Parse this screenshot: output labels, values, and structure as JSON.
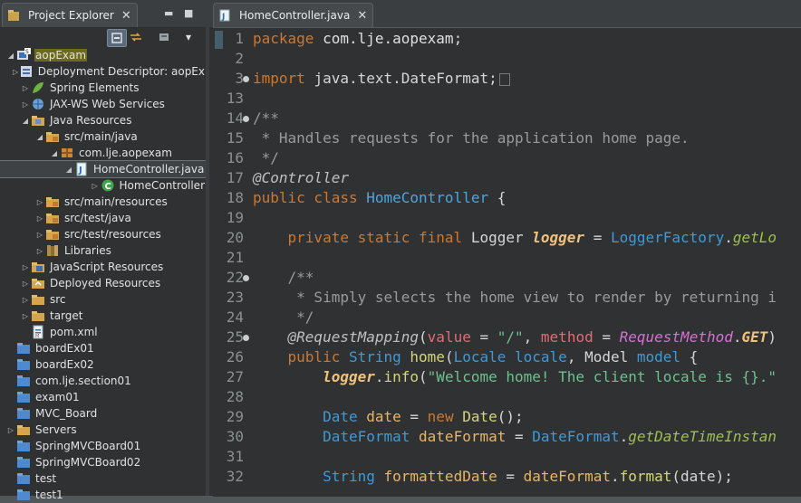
{
  "explorer": {
    "tab_title": "Project Explorer",
    "close": "✕",
    "min": "▬",
    "max": "■",
    "menu": "▾",
    "items": [
      {
        "label": "aopExam",
        "arrow": "open",
        "indent": 0,
        "icon": "project-icon"
      },
      {
        "label": "Deployment Descriptor: aopEx",
        "arrow": "closed",
        "indent": 1,
        "icon": "deployment-descriptor-icon"
      },
      {
        "label": "Spring Elements",
        "arrow": "closed",
        "indent": 1,
        "icon": "spring-leaf-icon"
      },
      {
        "label": "JAX-WS Web Services",
        "arrow": "closed",
        "indent": 1,
        "icon": "web-services-icon"
      },
      {
        "label": "Java Resources",
        "arrow": "open",
        "indent": 1,
        "icon": "java-resources-icon"
      },
      {
        "label": "src/main/java",
        "arrow": "open",
        "indent": 2,
        "icon": "source-folder-icon"
      },
      {
        "label": "com.lje.aopexam",
        "arrow": "open",
        "indent": 3,
        "icon": "package-icon"
      },
      {
        "label": "HomeController.java",
        "arrow": "open",
        "indent": 4,
        "icon": "java-file-icon"
      },
      {
        "label": "HomeController",
        "arrow": "closed",
        "indent": 5,
        "icon": "class-icon"
      },
      {
        "label": "src/main/resources",
        "arrow": "closed",
        "indent": 2,
        "icon": "source-folder-icon"
      },
      {
        "label": "src/test/java",
        "arrow": "closed",
        "indent": 2,
        "icon": "source-folder-icon"
      },
      {
        "label": "src/test/resources",
        "arrow": "closed",
        "indent": 2,
        "icon": "source-folder-icon"
      },
      {
        "label": "Libraries",
        "arrow": "closed",
        "indent": 2,
        "icon": "libraries-icon"
      },
      {
        "label": "JavaScript Resources",
        "arrow": "closed",
        "indent": 1,
        "icon": "javascript-resources-icon"
      },
      {
        "label": "Deployed Resources",
        "arrow": "closed",
        "indent": 1,
        "icon": "deployed-resources-icon"
      },
      {
        "label": "src",
        "arrow": "closed",
        "indent": 1,
        "icon": "folder-icon"
      },
      {
        "label": "target",
        "arrow": "closed",
        "indent": 1,
        "icon": "folder-icon"
      },
      {
        "label": "pom.xml",
        "arrow": "none",
        "indent": 1,
        "icon": "xml-file-icon"
      },
      {
        "label": "boardEx01",
        "arrow": "none",
        "indent": 0,
        "icon": "closed-project-icon"
      },
      {
        "label": "boardEx02",
        "arrow": "none",
        "indent": 0,
        "icon": "closed-project-icon"
      },
      {
        "label": "com.lje.section01",
        "arrow": "none",
        "indent": 0,
        "icon": "closed-project-icon"
      },
      {
        "label": "exam01",
        "arrow": "none",
        "indent": 0,
        "icon": "closed-project-icon"
      },
      {
        "label": "MVC_Board",
        "arrow": "none",
        "indent": 0,
        "icon": "closed-project-icon"
      },
      {
        "label": "Servers",
        "arrow": "closed",
        "indent": 0,
        "icon": "servers-folder-icon"
      },
      {
        "label": "SpringMVCBoard01",
        "arrow": "none",
        "indent": 0,
        "icon": "closed-project-icon"
      },
      {
        "label": "SpringMVCBoard02",
        "arrow": "none",
        "indent": 0,
        "icon": "closed-project-icon"
      },
      {
        "label": "test",
        "arrow": "none",
        "indent": 0,
        "icon": "closed-project-icon"
      },
      {
        "label": "test1",
        "arrow": "none",
        "indent": 0,
        "icon": "closed-project-icon"
      }
    ]
  },
  "editor": {
    "tab_title": "HomeController.java",
    "close": "✕",
    "lines": [
      {
        "n": "1",
        "fold": false,
        "segs": [
          [
            "kw",
            "package "
          ],
          [
            "pkg",
            "com.lje.aopexam"
          ],
          [
            "",
            "; "
          ]
        ]
      },
      {
        "n": "2",
        "fold": false,
        "segs": []
      },
      {
        "n": "3",
        "fold": true,
        "segs": [
          [
            "kw",
            "import "
          ],
          [
            "",
            "java.text.DateFormat;"
          ]
        ],
        "collapsed": true
      },
      {
        "n": "13",
        "fold": false,
        "segs": []
      },
      {
        "n": "14",
        "fold": true,
        "segs": [
          [
            "cmt",
            "/**"
          ]
        ]
      },
      {
        "n": "15",
        "fold": false,
        "segs": [
          [
            "cmt",
            " * Handles requests for the application home page."
          ]
        ]
      },
      {
        "n": "16",
        "fold": false,
        "segs": [
          [
            "cmt",
            " */"
          ]
        ]
      },
      {
        "n": "17",
        "fold": false,
        "segs": [
          [
            "ann",
            "@Controller"
          ]
        ]
      },
      {
        "n": "18",
        "fold": false,
        "segs": [
          [
            "kw",
            "public class "
          ],
          [
            "cls",
            "HomeController"
          ],
          [
            "",
            " {"
          ]
        ]
      },
      {
        "n": "19",
        "fold": false,
        "segs": []
      },
      {
        "n": "20",
        "fold": false,
        "segs": [
          [
            "",
            "    "
          ],
          [
            "kw",
            "private static final "
          ],
          [
            "",
            "Logger "
          ],
          [
            "field",
            "logger"
          ],
          [
            "",
            " = "
          ],
          [
            "type",
            "LoggerFactory"
          ],
          [
            "",
            "."
          ],
          [
            "staticm",
            "getLo"
          ]
        ]
      },
      {
        "n": "21",
        "fold": false,
        "segs": []
      },
      {
        "n": "22",
        "fold": true,
        "segs": [
          [
            "cmt",
            "    /**"
          ]
        ]
      },
      {
        "n": "23",
        "fold": false,
        "segs": [
          [
            "cmt",
            "     * Simply selects the home view to render by returning i"
          ]
        ]
      },
      {
        "n": "24",
        "fold": false,
        "segs": [
          [
            "cmt",
            "     */"
          ]
        ]
      },
      {
        "n": "25",
        "fold": true,
        "segs": [
          [
            "ann",
            "    @RequestMapping"
          ],
          [
            "",
            "("
          ],
          [
            "param",
            "value"
          ],
          [
            "",
            " = "
          ],
          [
            "str",
            "\"/\""
          ],
          [
            "",
            ", "
          ],
          [
            "param",
            "method"
          ],
          [
            "",
            " = "
          ],
          [
            "enum",
            "RequestMethod"
          ],
          [
            "",
            "."
          ],
          [
            "field",
            "GET"
          ],
          [
            "",
            ")"
          ]
        ]
      },
      {
        "n": "26",
        "fold": false,
        "segs": [
          [
            "",
            "    "
          ],
          [
            "kw",
            "public "
          ],
          [
            "type",
            "String "
          ],
          [
            "method",
            "home"
          ],
          [
            "",
            "("
          ],
          [
            "type",
            "Locale "
          ],
          [
            "type",
            "locale"
          ],
          [
            "",
            ", "
          ],
          [
            "",
            "Model "
          ],
          [
            "type",
            "model"
          ],
          [
            "",
            " {"
          ]
        ]
      },
      {
        "n": "27",
        "fold": false,
        "segs": [
          [
            "",
            "        "
          ],
          [
            "field",
            "logger"
          ],
          [
            "",
            "."
          ],
          [
            "method",
            "info"
          ],
          [
            "",
            "("
          ],
          [
            "str",
            "\"Welcome home! The client locale is {}.\""
          ]
        ]
      },
      {
        "n": "28",
        "fold": false,
        "segs": []
      },
      {
        "n": "29",
        "fold": false,
        "segs": [
          [
            "",
            "        "
          ],
          [
            "type",
            "Date "
          ],
          [
            "var",
            "date"
          ],
          [
            "",
            " = "
          ],
          [
            "kw",
            "new "
          ],
          [
            "method",
            "Date"
          ],
          [
            "",
            "();"
          ]
        ]
      },
      {
        "n": "30",
        "fold": false,
        "segs": [
          [
            "",
            "        "
          ],
          [
            "type",
            "DateFormat "
          ],
          [
            "var",
            "dateFormat"
          ],
          [
            "",
            " = "
          ],
          [
            "type",
            "DateFormat"
          ],
          [
            "",
            "."
          ],
          [
            "staticm",
            "getDateTimeInstan"
          ]
        ]
      },
      {
        "n": "31",
        "fold": false,
        "segs": []
      },
      {
        "n": "32",
        "fold": false,
        "segs": [
          [
            "",
            "        "
          ],
          [
            "type",
            "String "
          ],
          [
            "var",
            "formattedDate"
          ],
          [
            "",
            " = "
          ],
          [
            "var",
            "dateFormat"
          ],
          [
            "",
            "."
          ],
          [
            "method",
            "format"
          ],
          [
            "",
            "(date);"
          ]
        ]
      }
    ]
  }
}
